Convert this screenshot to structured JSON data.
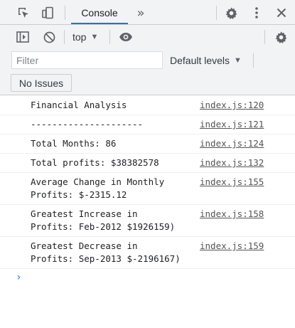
{
  "tabs": {
    "console_label": "Console",
    "more_tabs": "»"
  },
  "toolbar": {
    "context_label": "top",
    "filter_placeholder": "Filter",
    "levels_label": "Default levels",
    "issues_label": "No Issues"
  },
  "messages": [
    {
      "text": "Financial Analysis",
      "source": "index.js:120"
    },
    {
      "text": "---------------------",
      "source": "index.js:121"
    },
    {
      "text": "Total Months: 86",
      "source": "index.js:124"
    },
    {
      "text": "Total profits: $38382578",
      "source": "index.js:132"
    },
    {
      "text": "Average Change in Monthly\nProfits: $-2315.12",
      "source": "index.js:155"
    },
    {
      "text": "Greatest Increase in\nProfits: Feb-2012 $1926159)",
      "source": "index.js:158"
    },
    {
      "text": "Greatest Decrease in\nProfits: Sep-2013 $-2196167)",
      "source": "index.js:159"
    }
  ],
  "prompt_symbol": "›",
  "colors": {
    "accent": "#1a73e8",
    "toolbar_bg": "#f1f3f4",
    "icon_gray": "#5f6368"
  },
  "icons": [
    "inspect-element-icon",
    "device-toolbar-icon",
    "settings-gear-icon",
    "kebab-menu-icon",
    "close-icon",
    "sidebar-toggle-icon",
    "clear-console-icon",
    "live-expression-eye-icon",
    "console-settings-gear-icon",
    "prompt-chevron-icon"
  ]
}
